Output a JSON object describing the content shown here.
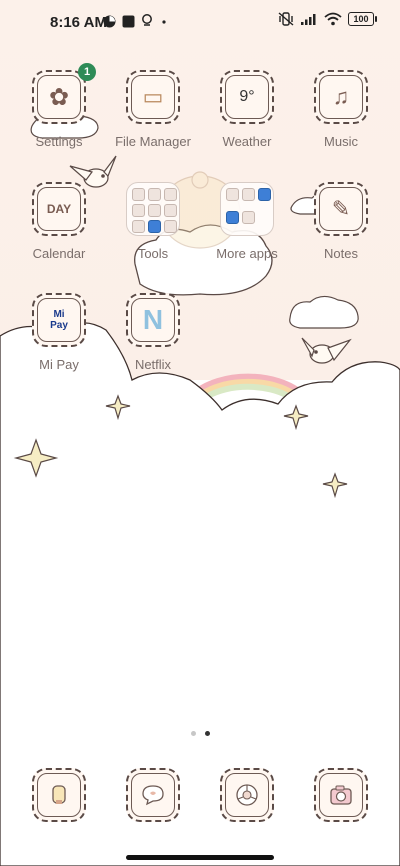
{
  "status_bar": {
    "time": "8:16 AM",
    "battery": "100",
    "left_icons": [
      "sync-icon",
      "square-notification-icon",
      "bulb-icon",
      "dot-icon"
    ],
    "right_icons": [
      "vibrate-off-icon",
      "signal-icon",
      "wifi-icon",
      "battery-icon"
    ]
  },
  "apps": [
    {
      "id": "settings",
      "label": "Settings",
      "badge": "1",
      "glyph": "✿"
    },
    {
      "id": "file-manager",
      "label": "File Manager",
      "glyph": "▭"
    },
    {
      "id": "weather",
      "label": "Weather",
      "glyph": "9°"
    },
    {
      "id": "music",
      "label": "Music",
      "glyph": "♫"
    },
    {
      "id": "calendar",
      "label": "Calendar",
      "glyph": "DAY"
    },
    {
      "id": "tools",
      "label": "Tools"
    },
    {
      "id": "more-apps",
      "label": "More apps"
    },
    {
      "id": "notes",
      "label": "Notes",
      "glyph": "✎"
    },
    {
      "id": "mi-pay",
      "label": "Mi Pay",
      "glyph": "Mi\nPay"
    },
    {
      "id": "netflix",
      "label": "Netflix",
      "glyph": "N"
    }
  ],
  "dock": [
    {
      "id": "phone",
      "icon": "phone-icon"
    },
    {
      "id": "messages",
      "icon": "message-icon"
    },
    {
      "id": "browser",
      "icon": "browser-icon"
    },
    {
      "id": "camera",
      "icon": "camera-icon"
    }
  ],
  "pages": {
    "count": 2,
    "active": 2
  },
  "colors": {
    "accent_badge": "#2e8b57",
    "icon_outline": "#5a4a46",
    "label": "#7a6e6b"
  }
}
